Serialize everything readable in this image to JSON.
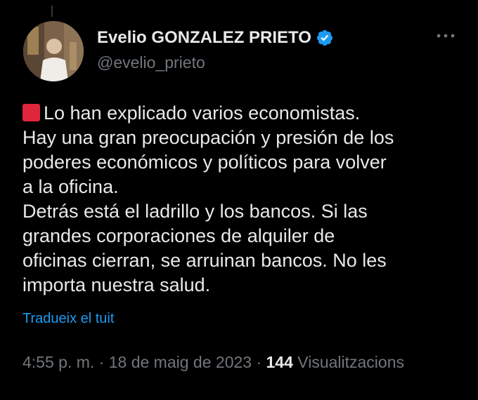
{
  "author": {
    "display_name": "Evelio GONZALEZ PRIETO",
    "handle": "@evelio_prieto",
    "verified": true
  },
  "tweet": {
    "lines": [
      "Lo han explicado varios economistas.",
      "Hay una gran preocupación y presión de los",
      "poderes económicos y políticos para volver",
      "a la oficina.",
      "Detrás está el ladrillo y los bancos. Si las",
      "grandes corporaciones de alquiler de",
      "oficinas cierran, se arruinan bancos. No les",
      "importa nuestra salud."
    ],
    "leading_emoji": "red-square-icon",
    "translate_label": "Tradueix el tuit"
  },
  "meta": {
    "time": "4:55 p. m.",
    "separator": "·",
    "date": "18 de maig de 2023",
    "views_count": "144",
    "views_label": "Visualitzacions"
  },
  "colors": {
    "background": "#000000",
    "text_primary": "#e7e9ea",
    "text_secondary": "#71767b",
    "link": "#1d9bf0",
    "verified_badge": "#1d9bf0",
    "emoji_red": "#e0263a"
  }
}
